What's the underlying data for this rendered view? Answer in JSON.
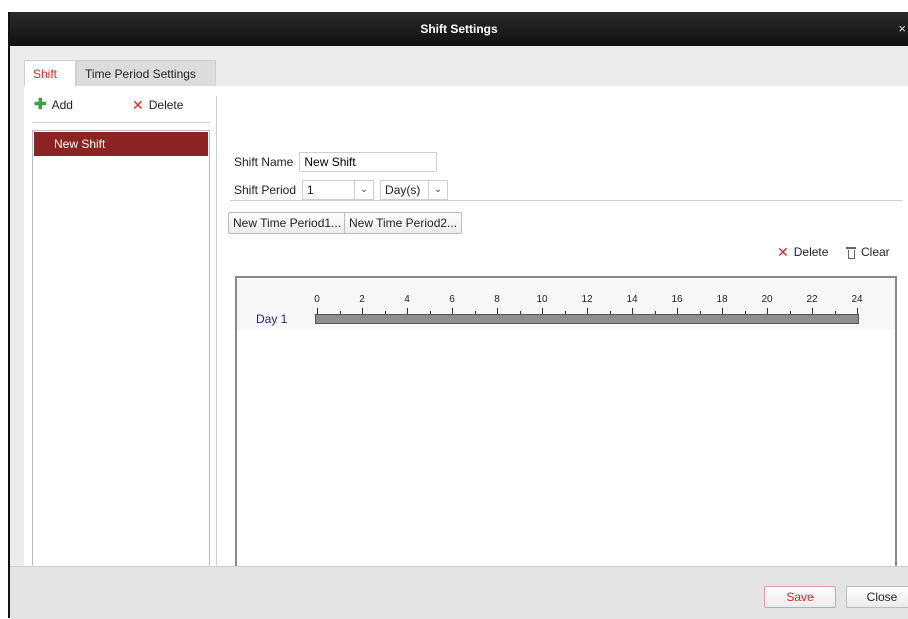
{
  "window": {
    "title": "Shift Settings",
    "close_glyph": "×"
  },
  "tabs": [
    {
      "label": "Shift",
      "active": true
    },
    {
      "label": "Time Period Settings",
      "active": false
    }
  ],
  "left_toolbar": {
    "add_label": "Add",
    "delete_label": "Delete"
  },
  "shift_list": {
    "items": [
      {
        "label": "New Shift",
        "selected": true
      }
    ]
  },
  "form": {
    "shift_name_label": "Shift Name",
    "shift_name_value": "New Shift",
    "shift_period_label": "Shift Period",
    "shift_period_value": "1",
    "unit_value": "Day(s)"
  },
  "time_periods": [
    "New Time Period1...",
    "New Time Period2..."
  ],
  "timeline_actions": {
    "delete_label": "Delete",
    "clear_label": "Clear"
  },
  "timeline": {
    "day_label": "Day 1",
    "hour_labels": [
      "0",
      "2",
      "4",
      "6",
      "8",
      "10",
      "12",
      "14",
      "16",
      "18",
      "20",
      "22",
      "24"
    ]
  },
  "footer": {
    "save_label": "Save",
    "close_label": "Close"
  },
  "colors": {
    "accent_red": "#d12b2b",
    "selected_row": "#8b2323",
    "titlebar": "#1a1a1a",
    "add_green": "#3aa43a"
  },
  "icons": {
    "add": "plus-icon",
    "delete": "x-icon",
    "clear": "trash-icon",
    "dropdown": "chevron-down-icon"
  }
}
